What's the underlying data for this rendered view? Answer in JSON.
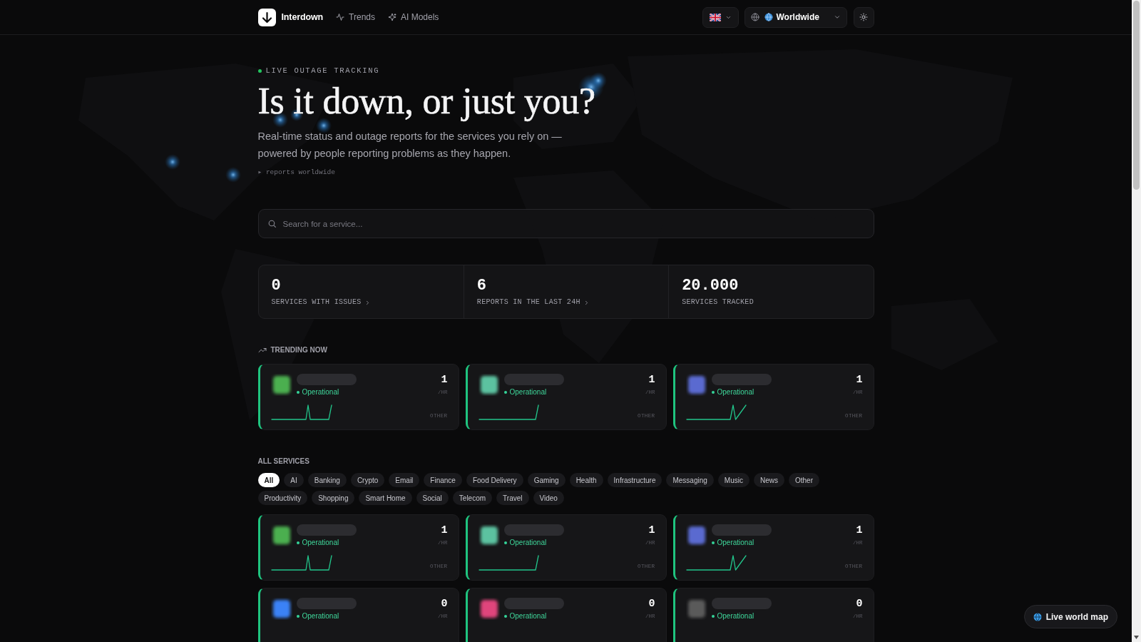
{
  "header": {
    "brand": "Interdown",
    "nav": [
      {
        "label": "Trends"
      },
      {
        "label": "AI Models"
      }
    ],
    "region": "Worldwide"
  },
  "hero": {
    "eyebrow": "LIVE OUTAGE TRACKING",
    "title": "Is it down, or just you?",
    "subtitle": "Real-time status and outage reports for the services you rely on — powered by people reporting problems as they happen.",
    "note": "▸ reports worldwide"
  },
  "search": {
    "placeholder": "Search for a service..."
  },
  "stats": [
    {
      "value": "0",
      "label": "SERVICES WITH ISSUES",
      "kind": "link"
    },
    {
      "value": "6",
      "label": "REPORTS IN THE LAST 24H",
      "kind": "link"
    },
    {
      "value": "20.000",
      "label": "SERVICES TRACKED",
      "kind": "plain"
    }
  ],
  "trending": {
    "title": "TRENDING NOW",
    "cards": [
      {
        "kind": "spike",
        "color": "#4caf50",
        "status": "Operational",
        "count": "1",
        "unit": "/HR",
        "category": "OTHER"
      },
      {
        "kind": "rise",
        "color": "#5cc2a0",
        "status": "Operational",
        "count": "1",
        "unit": "/HR",
        "category": "OTHER"
      },
      {
        "kind": "latespike",
        "color": "#5a6bd0",
        "status": "Operational",
        "count": "1",
        "unit": "/HR",
        "category": "OTHER"
      }
    ]
  },
  "all_services": {
    "title": "ALL SERVICES",
    "filters": [
      {
        "label": "All",
        "selected": true
      },
      {
        "label": "AI",
        "selected": false
      },
      {
        "label": "Banking",
        "selected": false
      },
      {
        "label": "Crypto",
        "selected": false
      },
      {
        "label": "Email",
        "selected": false
      },
      {
        "label": "Finance",
        "selected": false
      },
      {
        "label": "Food Delivery",
        "selected": false
      },
      {
        "label": "Gaming",
        "selected": false
      },
      {
        "label": "Health",
        "selected": false
      },
      {
        "label": "Infrastructure",
        "selected": false
      },
      {
        "label": "Messaging",
        "selected": false
      },
      {
        "label": "Music",
        "selected": false
      },
      {
        "label": "News",
        "selected": false
      },
      {
        "label": "Other",
        "selected": false
      },
      {
        "label": "Productivity",
        "selected": false
      },
      {
        "label": "Shopping",
        "selected": false
      },
      {
        "label": "Smart Home",
        "selected": false
      },
      {
        "label": "Social",
        "selected": false
      },
      {
        "label": "Telecom",
        "selected": false
      },
      {
        "label": "Travel",
        "selected": false
      },
      {
        "label": "Video",
        "selected": false
      }
    ],
    "cards": [
      {
        "kind": "spike",
        "color": "#4caf50",
        "status": "Operational",
        "count": "1",
        "unit": "/HR",
        "category": "OTHER"
      },
      {
        "kind": "rise",
        "color": "#5cc2a0",
        "status": "Operational",
        "count": "1",
        "unit": "/HR",
        "category": "OTHER"
      },
      {
        "kind": "latespike",
        "color": "#5a6bd0",
        "status": "Operational",
        "count": "1",
        "unit": "/HR",
        "category": "OTHER"
      },
      {
        "kind": "quiet",
        "color": "#3b82f6",
        "status": "Operational",
        "count": "0",
        "unit": "/HR"
      },
      {
        "kind": "quiet",
        "color": "#e0457b",
        "status": "Operational",
        "count": "0",
        "unit": "/HR"
      },
      {
        "kind": "quiet",
        "color": "#5a5a5a",
        "status": "Operational",
        "count": "0",
        "unit": "/HR"
      }
    ]
  },
  "live_map_button": {
    "label": "Live world map"
  }
}
